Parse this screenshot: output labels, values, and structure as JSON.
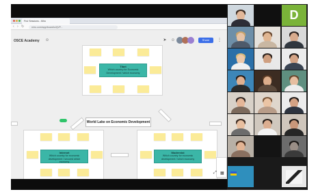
{
  "browser": {
    "tab_title": "Frui Sessions - Miro",
    "url": "miro.com/app/board/uXjVP..."
  },
  "board": {
    "brand": "OSCE Academy",
    "share_label": "Share",
    "central_label": "World Lake on Economic Development",
    "frame_top": {
      "heading": "Tibet",
      "text": "Which country for Economic Development / which economy"
    },
    "frame_left": {
      "heading": "Internet",
      "text": "Which country for economic development / secured which economy"
    },
    "frame_right": {
      "heading": "Modernist",
      "text": "Which country for economic development / which economy"
    }
  },
  "participants": {
    "initial": "D",
    "colors": {
      "accent_green": "#7ab339",
      "teal": "#3bb6a7",
      "sticky": "#fbeb98"
    }
  }
}
